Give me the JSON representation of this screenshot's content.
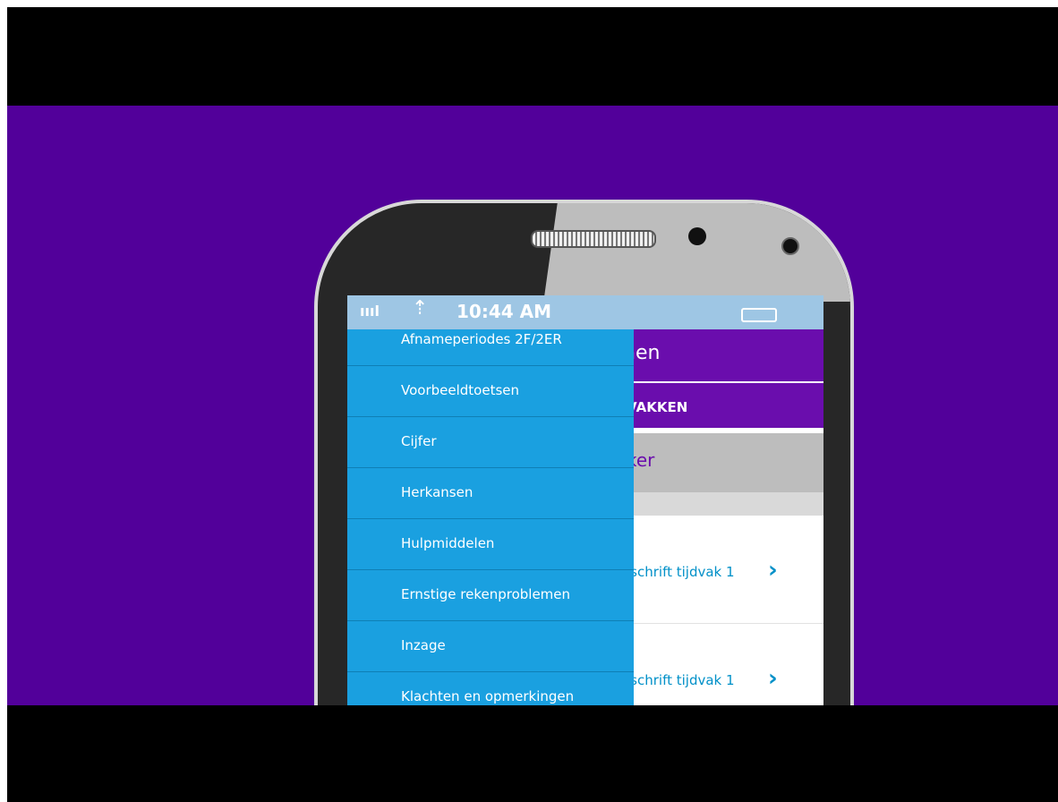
{
  "status_bar": {
    "signal": "ıııl",
    "wifi": "⇡",
    "time": "10:44 AM"
  },
  "app": {
    "header_title": "nen",
    "tab_label": "VAKKEN",
    "subheader": "ker",
    "rows": [
      {
        "text": "rschrift tijdvak 1"
      },
      {
        "text": "rschrift tijdvak 1"
      }
    ]
  },
  "drawer": {
    "items": [
      {
        "label": "Afnameperiodes 2F/2ER"
      },
      {
        "label": "Voorbeeldtoetsen"
      },
      {
        "label": "Cijfer"
      },
      {
        "label": "Herkansen"
      },
      {
        "label": "Hulpmiddelen"
      },
      {
        "label": "Ernstige rekenproblemen"
      },
      {
        "label": "Inzage"
      },
      {
        "label": "Klachten en opmerkingen"
      }
    ]
  },
  "colors": {
    "background": "#52009a",
    "drawer": "#1aa0e0",
    "app_purple": "#6a0dad",
    "status_bar": "#9ec6e4"
  }
}
